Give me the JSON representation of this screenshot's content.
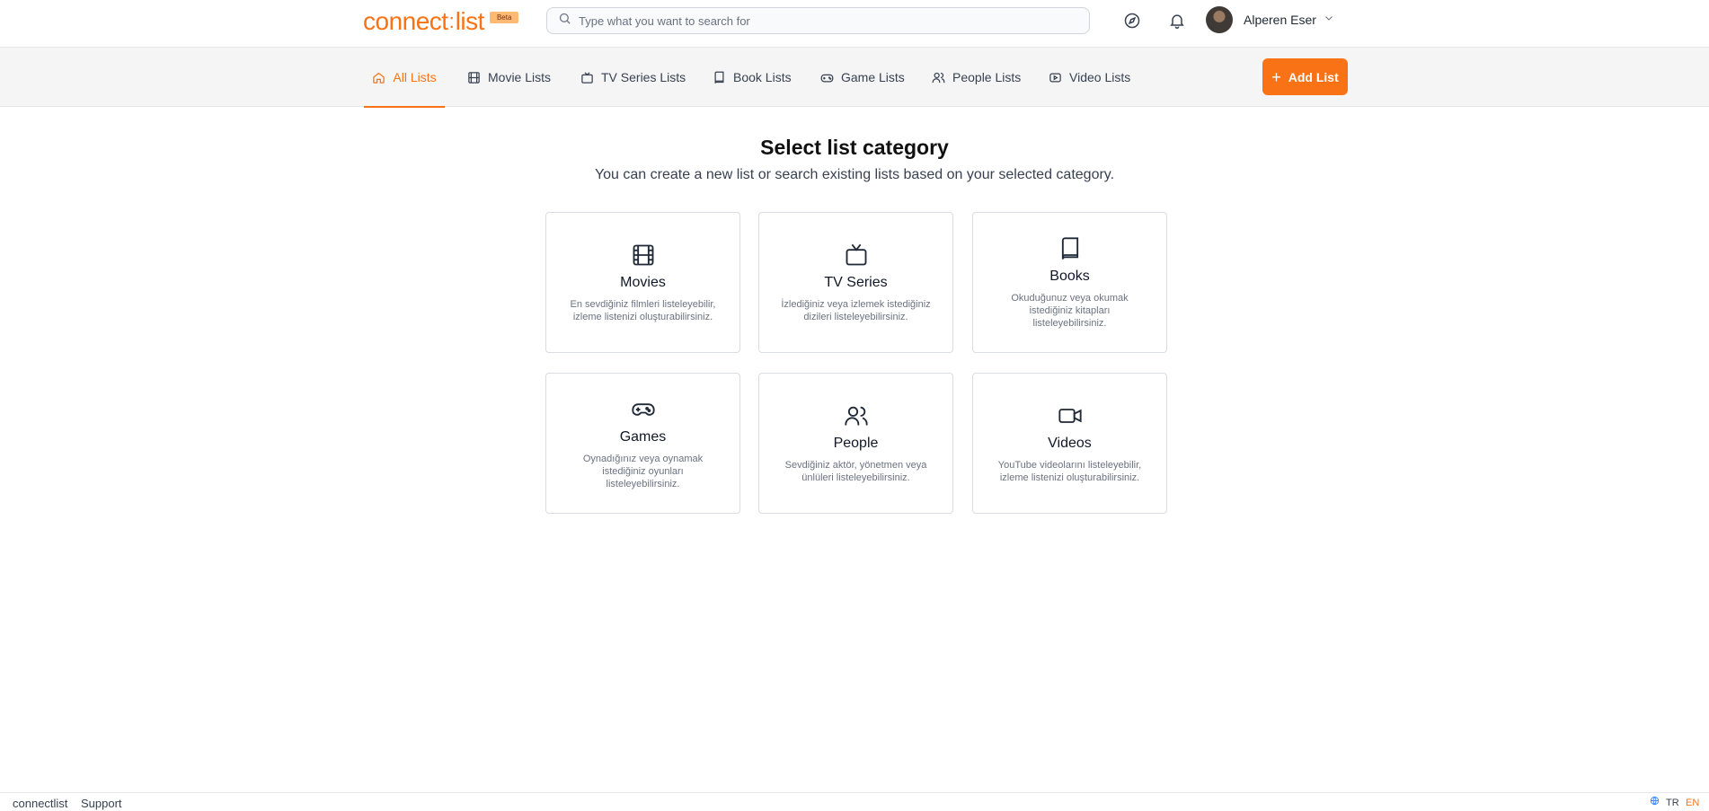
{
  "header": {
    "logo_text_left": "connect",
    "logo_text_right": "list",
    "beta_label": "Beta",
    "search_placeholder": "Type what you want to search for",
    "icons": [
      "search-icon",
      "compass-icon",
      "bell-icon",
      "chevron-down-icon"
    ],
    "user_name": "Alperen Eser"
  },
  "nav": {
    "tabs": [
      {
        "label": "All Lists",
        "icon": "home-icon",
        "active": true
      },
      {
        "label": "Movie Lists",
        "icon": "film-icon"
      },
      {
        "label": "TV Series Lists",
        "icon": "tv-icon"
      },
      {
        "label": "Book Lists",
        "icon": "book-icon"
      },
      {
        "label": "Game Lists",
        "icon": "gamepad-icon"
      },
      {
        "label": "People Lists",
        "icon": "users-icon"
      },
      {
        "label": "Video Lists",
        "icon": "video-icon"
      }
    ],
    "add_button_label": "Add List"
  },
  "main": {
    "title": "Select list category",
    "subtitle": "You can create a new list or search existing lists based on your selected category.",
    "categories": [
      {
        "title": "Movies",
        "icon": "film-icon",
        "description": "En sevdiğiniz filmleri listeleyebilir, izleme listenizi oluşturabilirsiniz."
      },
      {
        "title": "TV Series",
        "icon": "tv-icon",
        "description": "İzlediğiniz veya izlemek istediğiniz dizileri listeleyebilirsiniz."
      },
      {
        "title": "Books",
        "icon": "book-icon",
        "description": "Okuduğunuz veya okumak istediğiniz kitapları listeleyebilirsiniz."
      },
      {
        "title": "Games",
        "icon": "gamepad-icon",
        "description": "Oynadığınız veya oynamak istediğiniz oyunları listeleyebilirsiniz."
      },
      {
        "title": "People",
        "icon": "users-icon",
        "description": "Sevdiğiniz aktör, yönetmen veya ünlüleri listeleyebilirsiniz."
      },
      {
        "title": "Videos",
        "icon": "video-icon",
        "description": "YouTube videolarını listeleyebilir, izleme listenizi oluşturabilirsiniz."
      }
    ]
  },
  "footer": {
    "brand": "connectlist",
    "support": "Support",
    "lang_tr": "TR",
    "lang_en": "EN"
  },
  "colors": {
    "accent": "#f97316",
    "card_border": "#d9dce1",
    "text_muted": "#6b7280"
  }
}
